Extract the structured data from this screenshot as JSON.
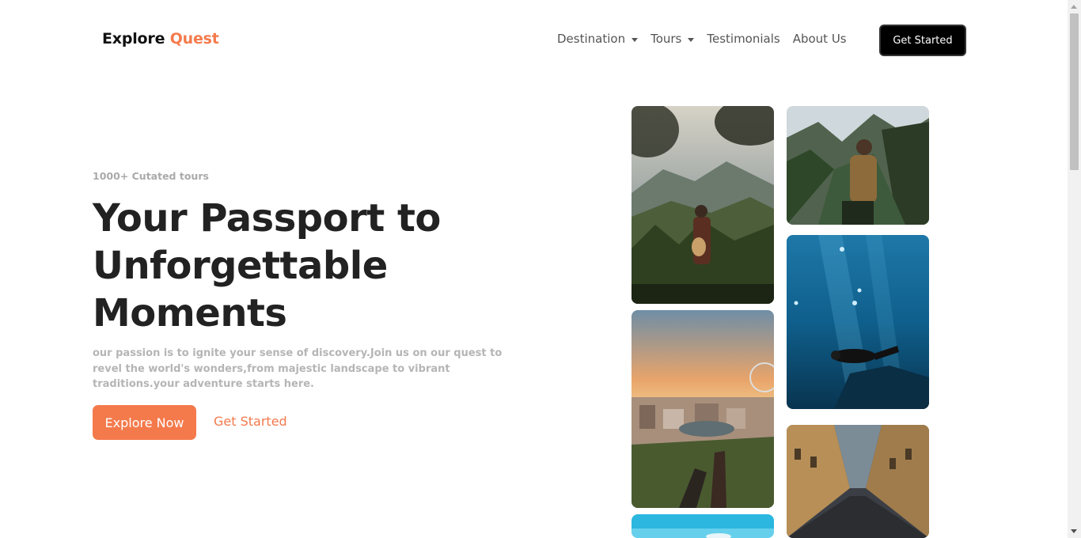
{
  "brand": {
    "name": "Explore",
    "accent": "Quest"
  },
  "nav": {
    "items": [
      {
        "label": "Destination",
        "dropdown": true
      },
      {
        "label": "Tours",
        "dropdown": true
      },
      {
        "label": "Testimonials",
        "dropdown": false
      },
      {
        "label": "About Us",
        "dropdown": false
      }
    ],
    "cta_label": "Get Started"
  },
  "hero": {
    "eyebrow": "1000+ Cutated tours",
    "headline_lines": [
      "Your Passport to",
      "Unforgettable",
      "Moments"
    ],
    "description": "our passion is to ignite your sense of discovery.Join us on our quest to revel the world's wonders,from majestic landscape to vibrant traditions.your adventure starts here.",
    "primary_button": "Explore Now",
    "secondary_link": "Get Started"
  },
  "gallery": {
    "images": [
      {
        "name": "guitarist-mountain-photo"
      },
      {
        "name": "hiker-forest-valley-photo"
      },
      {
        "name": "scuba-diver-ocean-photo"
      },
      {
        "name": "city-sunset-overlook-photo"
      },
      {
        "name": "cobblestone-street-photo"
      },
      {
        "name": "sky-beach-photo"
      }
    ]
  },
  "colors": {
    "accent": "#f47a4c",
    "dark_button": "#000000",
    "heading": "#222222",
    "muted": "#b5b5b5"
  }
}
